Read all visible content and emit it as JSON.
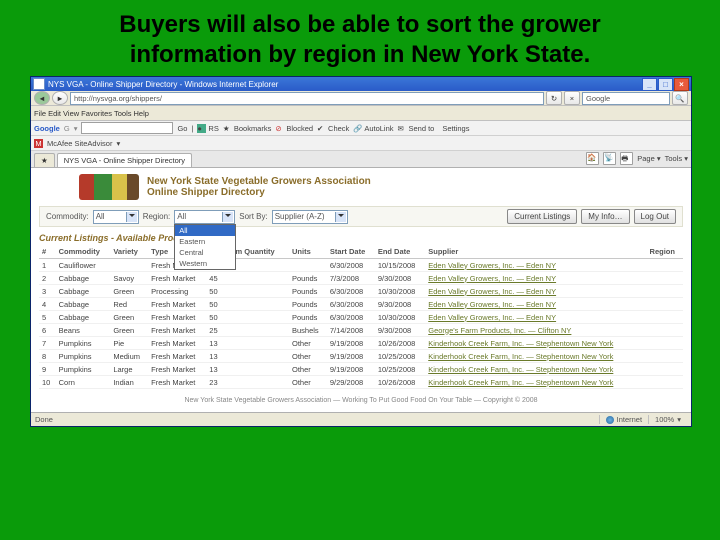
{
  "slide_title": "Buyers will also be able to sort the grower information by region in New York State.",
  "browser": {
    "window_title": "NYS VGA - Online Shipper Directory - Windows Internet Explorer",
    "url": "http://nysvga.org/shippers/",
    "search_engine": "Google",
    "menu": [
      "File",
      "Edit",
      "View",
      "Favorites",
      "Tools",
      "Help"
    ],
    "google_toolbar": {
      "brand": "Google",
      "go": "Go",
      "items": [
        "RS",
        "Bookmarks",
        "Blocked",
        "Check",
        "AutoLink",
        "Send to"
      ],
      "settings": "Settings"
    },
    "mcafee": "McAfee SiteAdvisor",
    "tab_label": "NYS VGA - Online Shipper Directory",
    "toolbar_right": [
      "Page",
      "Tools"
    ],
    "status": {
      "done": "Done",
      "zone": "Internet",
      "zoom": "100%"
    }
  },
  "assoc": {
    "l1": "New York State Vegetable Growers Association",
    "l2": "Online Shipper Directory"
  },
  "filters": {
    "commodity_label": "Commodity:",
    "commodity_value": "All",
    "region_label": "Region:",
    "region_value": "All",
    "region_options": [
      "All",
      "Eastern",
      "Central",
      "Western"
    ],
    "sortby_label": "Sort By:",
    "sortby_value": "Supplier (A-Z)",
    "btn_listings": "Current Listings",
    "btn_myinfo": "My Info…",
    "btn_logout": "Log Out"
  },
  "section_title": "Current Listings - Available Produce",
  "cols": [
    "#",
    "Commodity",
    "Variety",
    "Type",
    "Minimum Quantity",
    "Units",
    "Start Date",
    "End Date",
    "Supplier",
    "Region"
  ],
  "rows": [
    {
      "n": "1",
      "c": "Cauliflower",
      "v": "",
      "t": "Fresh Market",
      "q": "",
      "u": "",
      "s": "6/30/2008",
      "e": "10/15/2008",
      "sup": "Eden Valley Growers, Inc. — Eden NY",
      "r": ""
    },
    {
      "n": "2",
      "c": "Cabbage",
      "v": "Savoy",
      "t": "Fresh Market",
      "q": "45",
      "u": "Pounds",
      "s": "7/3/2008",
      "e": "9/30/2008",
      "sup": "Eden Valley Growers, Inc. — Eden NY",
      "r": ""
    },
    {
      "n": "3",
      "c": "Cabbage",
      "v": "Green",
      "t": "Processing",
      "q": "50",
      "u": "Pounds",
      "s": "6/30/2008",
      "e": "10/30/2008",
      "sup": "Eden Valley Growers, Inc. — Eden NY",
      "r": ""
    },
    {
      "n": "4",
      "c": "Cabbage",
      "v": "Red",
      "t": "Fresh Market",
      "q": "50",
      "u": "Pounds",
      "s": "6/30/2008",
      "e": "9/30/2008",
      "sup": "Eden Valley Growers, Inc. — Eden NY",
      "r": ""
    },
    {
      "n": "5",
      "c": "Cabbage",
      "v": "Green",
      "t": "Fresh Market",
      "q": "50",
      "u": "Pounds",
      "s": "6/30/2008",
      "e": "10/30/2008",
      "sup": "Eden Valley Growers, Inc. — Eden NY",
      "r": ""
    },
    {
      "n": "6",
      "c": "Beans",
      "v": "Green",
      "t": "Fresh Market",
      "q": "25",
      "u": "Bushels",
      "s": "7/14/2008",
      "e": "9/30/2008",
      "sup": "George's Farm Products, Inc. — Clifton NY",
      "r": ""
    },
    {
      "n": "7",
      "c": "Pumpkins",
      "v": "Pie",
      "t": "Fresh Market",
      "q": "13",
      "u": "Other",
      "s": "9/19/2008",
      "e": "10/26/2008",
      "sup": "Kinderhook Creek Farm, Inc. — Stephentown New York",
      "r": ""
    },
    {
      "n": "8",
      "c": "Pumpkins",
      "v": "Medium",
      "t": "Fresh Market",
      "q": "13",
      "u": "Other",
      "s": "9/19/2008",
      "e": "10/25/2008",
      "sup": "Kinderhook Creek Farm, Inc. — Stephentown New York",
      "r": ""
    },
    {
      "n": "9",
      "c": "Pumpkins",
      "v": "Large",
      "t": "Fresh Market",
      "q": "13",
      "u": "Other",
      "s": "9/19/2008",
      "e": "10/25/2008",
      "sup": "Kinderhook Creek Farm, Inc. — Stephentown New York",
      "r": ""
    },
    {
      "n": "10",
      "c": "Corn",
      "v": "Indian",
      "t": "Fresh Market",
      "q": "23",
      "u": "Other",
      "s": "9/29/2008",
      "e": "10/26/2008",
      "sup": "Kinderhook Creek Farm, Inc. — Stephentown New York",
      "r": ""
    }
  ],
  "footer": "New York State Vegetable Growers Association   —  Working To Put Good Food On Your Table  —   Copyright © 2008"
}
